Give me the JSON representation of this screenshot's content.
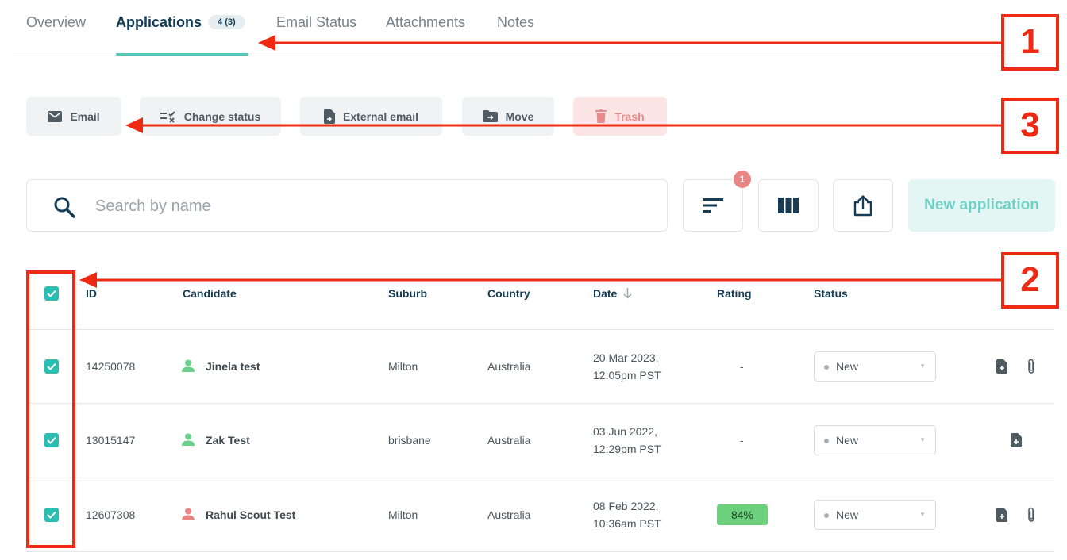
{
  "tabs": [
    {
      "label": "Overview"
    },
    {
      "label": "Applications",
      "badge": "4 (3)"
    },
    {
      "label": "Email Status"
    },
    {
      "label": "Attachments"
    },
    {
      "label": "Notes"
    }
  ],
  "actions": {
    "email": "Email",
    "change_status": "Change status",
    "external_email": "External email",
    "move": "Move",
    "trash": "Trash"
  },
  "search": {
    "placeholder": "Search by name"
  },
  "toolbar": {
    "filter_count": "1",
    "new_application": "New application"
  },
  "table": {
    "headers": {
      "id": "ID",
      "candidate": "Candidate",
      "suburb": "Suburb",
      "country": "Country",
      "date": "Date",
      "rating": "Rating",
      "status": "Status"
    },
    "rows": [
      {
        "id": "14250078",
        "candidate": "Jinela test",
        "suburb": "Milton",
        "country": "Australia",
        "date_line1": "20 Mar 2023,",
        "date_line2": "12:05pm PST",
        "rating": "-",
        "status": "New",
        "person_color": "#6ccf8a",
        "has_attachment": true
      },
      {
        "id": "13015147",
        "candidate": "Zak Test",
        "suburb": "brisbane",
        "country": "Australia",
        "date_line1": "03 Jun 2022,",
        "date_line2": "12:29pm PST",
        "rating": "-",
        "status": "New",
        "person_color": "#6ccf8a",
        "has_attachment": false
      },
      {
        "id": "12607308",
        "candidate": "Rahul Scout Test",
        "suburb": "Milton",
        "country": "Australia",
        "date_line1": "08 Feb 2022,",
        "date_line2": "10:36am PST",
        "rating": "84%",
        "status": "New",
        "person_color": "#e98583",
        "has_attachment": true
      }
    ]
  },
  "annotations": {
    "one": "1",
    "two": "2",
    "three": "3"
  },
  "colors": {
    "accent": "#2bbfb4",
    "annotation": "#ee2a12",
    "heading": "#123c56"
  }
}
